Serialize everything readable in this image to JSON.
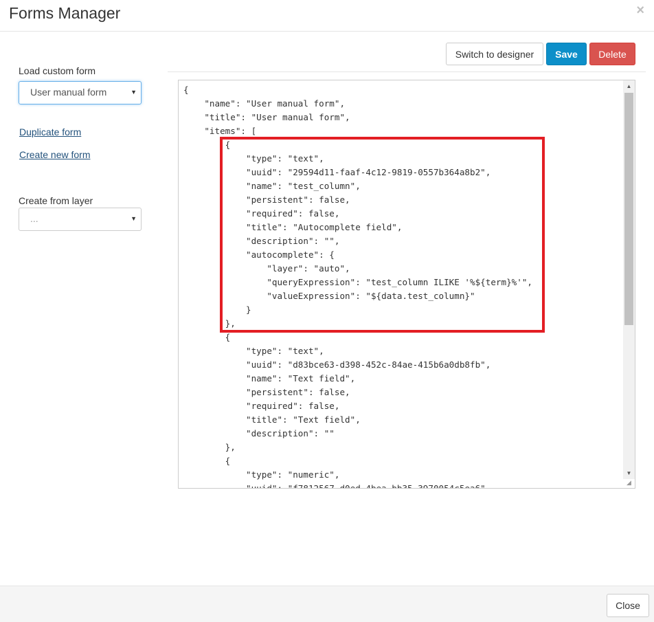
{
  "header": {
    "title": "Forms Manager",
    "close_glyph": "×"
  },
  "sidebar": {
    "load_label": "Load custom form",
    "load_select_value": "User manual form",
    "duplicate_link": "Duplicate form",
    "create_link": "Create new form",
    "layer_label": "Create from layer",
    "layer_select_value": "..."
  },
  "toolbar": {
    "switch_label": "Switch to designer",
    "save_label": "Save",
    "delete_label": "Delete"
  },
  "editor": {
    "code": "{\n    \"name\": \"User manual form\",\n    \"title\": \"User manual form\",\n    \"items\": [\n        {\n            \"type\": \"text\",\n            \"uuid\": \"29594d11-faaf-4c12-9819-0557b364a8b2\",\n            \"name\": \"test_column\",\n            \"persistent\": false,\n            \"required\": false,\n            \"title\": \"Autocomplete field\",\n            \"description\": \"\",\n            \"autocomplete\": {\n                \"layer\": \"auto\",\n                \"queryExpression\": \"test_column ILIKE '%${term}%'\",\n                \"valueExpression\": \"${data.test_column}\"\n            }\n        },\n        {\n            \"type\": \"text\",\n            \"uuid\": \"d83bce63-d398-452c-84ae-415b6a0db8fb\",\n            \"name\": \"Text field\",\n            \"persistent\": false,\n            \"required\": false,\n            \"title\": \"Text field\",\n            \"description\": \"\"\n        },\n        {\n            \"type\": \"numeric\",\n            \"uuid\": \"f7812567-d0ed-4bea-bb35-3970054c5ea6\","
  },
  "footer": {
    "close_label": "Close"
  },
  "colors": {
    "highlight": "#e31e24",
    "primary": "#0d8fc9",
    "danger": "#d9534f"
  }
}
